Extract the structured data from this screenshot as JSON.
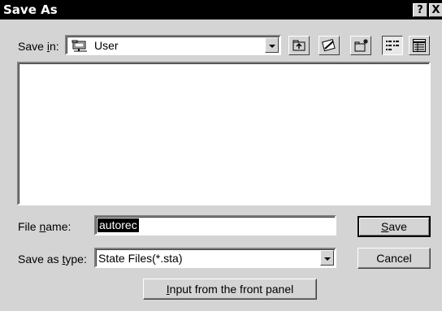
{
  "window": {
    "title": "Save As",
    "help_glyph": "?",
    "close_glyph": "X"
  },
  "toolbar": {
    "save_in_label_pre": "Save ",
    "save_in_label_key": "i",
    "save_in_label_post": "n:",
    "location": "User",
    "location_icon": "network-folder-icon",
    "buttons": [
      "up-one-level-icon",
      "desktop-icon",
      "new-folder-icon",
      "list-view-icon",
      "details-view-icon"
    ]
  },
  "form": {
    "file_name_label_pre": "File ",
    "file_name_label_key": "n",
    "file_name_label_post": "ame:",
    "file_name_value": "autorec",
    "type_label_pre": "Save as ",
    "type_label_key": "t",
    "type_label_post": "ype:",
    "type_value": "State Files(*.sta)"
  },
  "buttons": {
    "save_key": "S",
    "save_rest": "ave",
    "cancel": "Cancel",
    "input_key": "I",
    "input_rest": "nput from the front panel"
  }
}
